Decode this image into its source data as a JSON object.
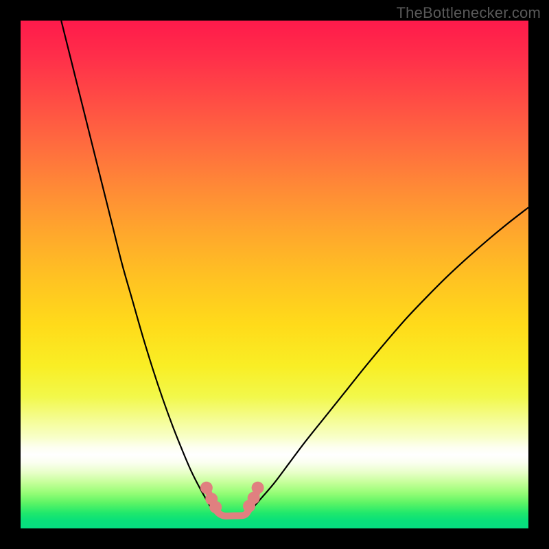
{
  "watermark": "TheBottlenecker.com",
  "chart_data": {
    "type": "line",
    "title": "",
    "xlabel": "",
    "ylabel": "",
    "xlim": [
      0,
      100
    ],
    "ylim": [
      0,
      100
    ],
    "grid": false,
    "legend": false,
    "background": "rainbow-vertical-gradient",
    "series": [
      {
        "name": "left-curve",
        "stroke": "#000000",
        "x": [
          8,
          10,
          12,
          14,
          16,
          18,
          20,
          22,
          24,
          26,
          28,
          30,
          32,
          33.5,
          35,
          36.5,
          38
        ],
        "y": [
          100,
          92,
          84,
          76,
          68,
          60,
          52,
          45,
          38,
          31.5,
          25.5,
          20,
          15,
          11.5,
          8.5,
          5.8,
          3.2
        ]
      },
      {
        "name": "right-curve",
        "stroke": "#000000",
        "x": [
          45,
          47,
          50,
          53,
          56,
          60,
          64,
          68,
          72,
          76,
          80,
          84,
          88,
          92,
          96,
          100
        ],
        "y": [
          3.2,
          5.5,
          9,
          13,
          17,
          22,
          27,
          32,
          36.8,
          41.4,
          45.6,
          49.6,
          53.3,
          56.8,
          60.1,
          63.2
        ]
      },
      {
        "name": "valley-floor",
        "stroke": "#e08080",
        "x": [
          36.5,
          37.5,
          38.2,
          38.8,
          40,
          42,
          44,
          44.8,
          45.4,
          46.2,
          47
        ],
        "y": [
          8.2,
          6.0,
          4.4,
          3.2,
          2.5,
          2.5,
          2.6,
          3.4,
          4.6,
          6.2,
          8.4
        ]
      },
      {
        "name": "left-beads",
        "type": "scatter",
        "color": "#e08080",
        "x": [
          36.6,
          37.6,
          38.4
        ],
        "y": [
          8.0,
          5.8,
          4.2
        ]
      },
      {
        "name": "right-beads",
        "type": "scatter",
        "color": "#e08080",
        "x": [
          45.0,
          45.9,
          46.7
        ],
        "y": [
          4.4,
          6.0,
          8.0
        ]
      }
    ]
  }
}
